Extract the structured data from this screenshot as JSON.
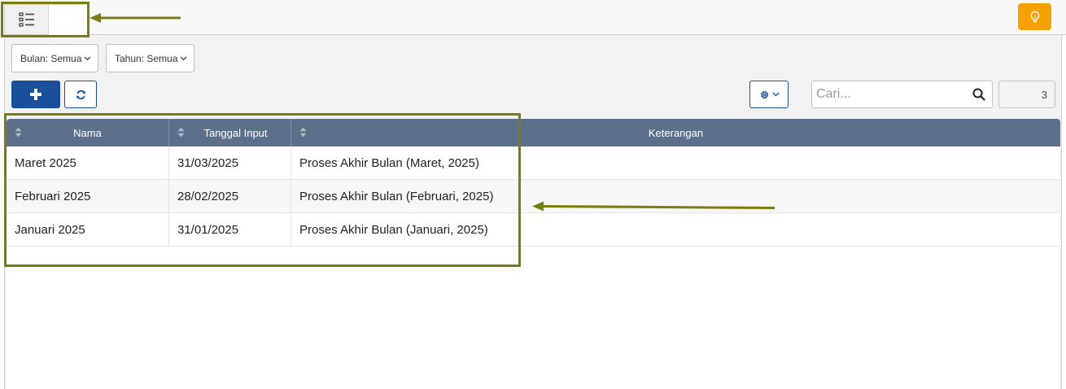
{
  "toolbar": {
    "list_tab_icon": "list-icon",
    "bulb_icon": "lightbulb-icon"
  },
  "filters": {
    "month": "Bulan: Semua",
    "year": "Tahun: Semua"
  },
  "actions": {
    "add_icon": "plus-icon",
    "refresh_icon": "refresh-icon",
    "settings_icon": "gear-icon"
  },
  "search": {
    "placeholder": "Cari..."
  },
  "record_count": "3",
  "table": {
    "columns": [
      "Nama",
      "Tanggal Input",
      "Keterangan"
    ],
    "rows": [
      [
        "Maret 2025",
        "31/03/2025",
        "Proses Akhir Bulan (Maret, 2025)"
      ],
      [
        "Februari 2025",
        "28/02/2025",
        "Proses Akhir Bulan (Februari, 2025)"
      ],
      [
        "Januari 2025",
        "31/01/2025",
        "Proses Akhir Bulan (Januari, 2025)"
      ]
    ]
  },
  "colors": {
    "header_bg": "#5c7089",
    "primary": "#1a4f9c",
    "warning": "#f5a100",
    "annotation": "#7c7d10"
  }
}
